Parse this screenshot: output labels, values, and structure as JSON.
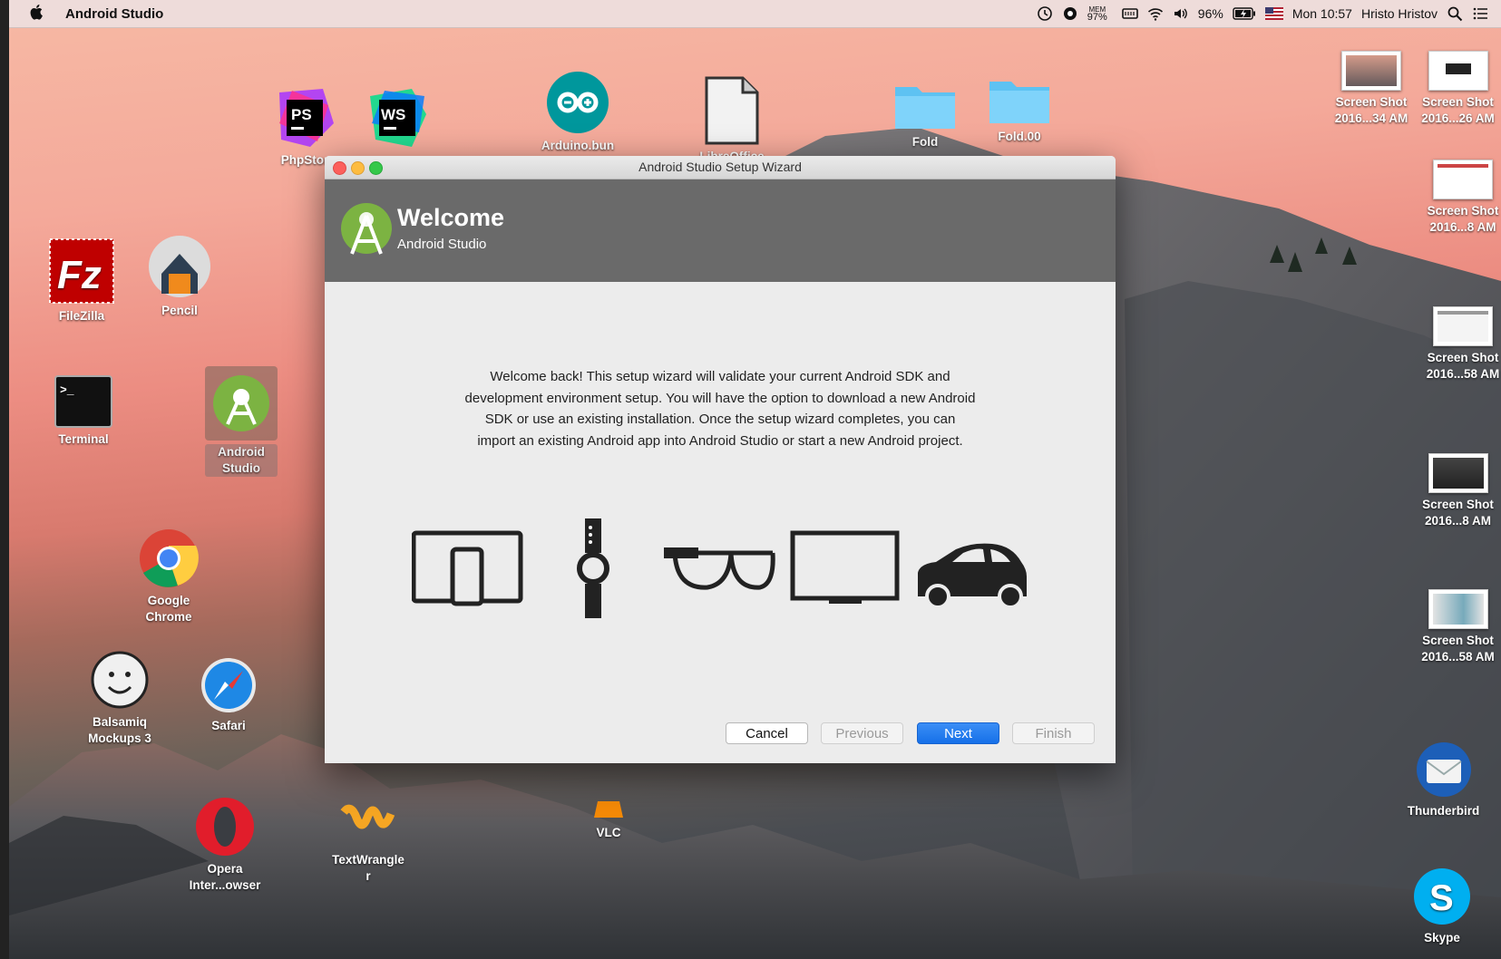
{
  "menubar": {
    "app_name": "Android Studio",
    "mem_label": "MEM",
    "mem_value": "97%",
    "battery": "96%",
    "clock": "Mon 10:57",
    "user": "Hristo Hristov"
  },
  "desktop_icons": {
    "phpstorm": "PhpStor",
    "webstorm": "",
    "arduino": "Arduino.bun",
    "libreoffice": "LibreOffice",
    "fold1": "Fold",
    "fold2": "Fold.00",
    "filezilla": "FileZilla",
    "pencil": "Pencil",
    "terminal": "Terminal",
    "android_studio_1": "Android",
    "android_studio_2": "Studio",
    "chrome_1": "Google",
    "chrome_2": "Chrome",
    "balsamiq_1": "Balsamiq",
    "balsamiq_2": "Mockups 3",
    "safari": "Safari",
    "opera_1": "Opera",
    "opera_2": "Inter...owser",
    "textwrangler_1": "TextWrangle",
    "textwrangler_2": "r",
    "vlc": "VLC",
    "thunderbird": "Thunderbird",
    "skype": "Skype",
    "shots": [
      {
        "l1": "Screen Shot",
        "l2": "2016...34 AM"
      },
      {
        "l1": "Screen Shot",
        "l2": "2016...26 AM"
      },
      {
        "l1": "Screen Shot",
        "l2": "2016...8 AM"
      },
      {
        "l1": "Screen Shot",
        "l2": "2016...58 AM"
      },
      {
        "l1": "Screen Shot",
        "l2": "2016...8 AM"
      },
      {
        "l1": "Screen Shot",
        "l2": "2016...58 AM"
      }
    ]
  },
  "wizard": {
    "window_title": "Android Studio Setup Wizard",
    "header_title": "Welcome",
    "header_subtitle": "Android Studio",
    "body_lines": [
      "Welcome back! This setup wizard will validate your current Android SDK and",
      "development environment setup. You will have the option to download a new Android",
      "SDK or use an existing installation. Once the setup wizard completes, you can",
      "import an existing Android app into Android Studio or start a new Android project."
    ],
    "buttons": {
      "cancel": "Cancel",
      "previous": "Previous",
      "next": "Next",
      "finish": "Finish"
    }
  },
  "colors": {
    "accent": "#1670e8",
    "header_bg": "#6a6a6a",
    "android_green": "#7cb342"
  }
}
